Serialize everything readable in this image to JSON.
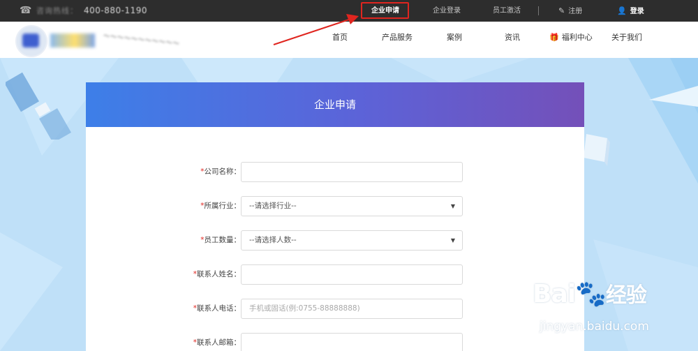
{
  "topbar": {
    "hotline_label": "咨询热线：",
    "hotline_number": "400-880-1190",
    "links": {
      "apply": "企业申请",
      "login_enterprise": "企业登录",
      "activate": "员工激活",
      "register": "注册",
      "login": "登录"
    }
  },
  "nav": {
    "items": [
      "首页",
      "产品服务",
      "案例",
      "资讯",
      "福利中心",
      "关于我们"
    ]
  },
  "card": {
    "title": "企业申请",
    "fields": [
      {
        "label": "公司名称：",
        "value": "",
        "placeholder": ""
      },
      {
        "label": "所属行业：",
        "value": "--请选择行业--",
        "type": "select"
      },
      {
        "label": "员工数量：",
        "value": "--请选择人数--",
        "type": "select"
      },
      {
        "label": "联系人姓名：",
        "value": "",
        "placeholder": ""
      },
      {
        "label": "联系人电话：",
        "value": "",
        "placeholder": "手机或固话(例:0755-88888888)"
      },
      {
        "label": "联系人邮箱：",
        "value": "",
        "placeholder": ""
      }
    ]
  },
  "watermark": {
    "brand": "Bai",
    "brand2": "经验",
    "url": "jingyan.baidu.com"
  },
  "colors": {
    "highlight": "#e0251f",
    "header_start": "#3d7fe8",
    "header_end": "#7450b9",
    "background": "#bfe0f8"
  }
}
